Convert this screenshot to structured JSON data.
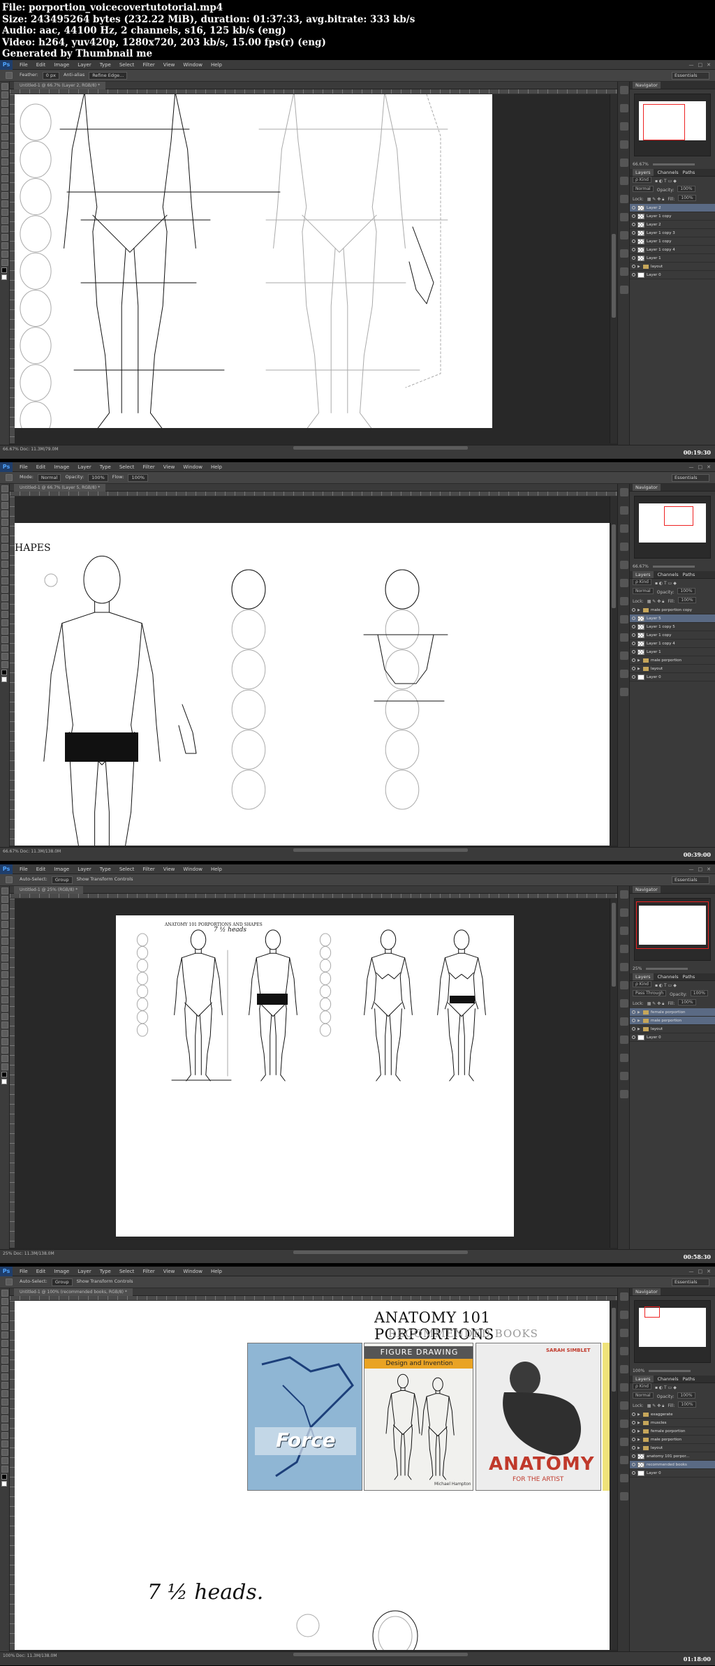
{
  "file_info": {
    "file": "File: porportion_voicecovertutotorial.mp4",
    "size": "Size: 243495264 bytes (232.22 MiB), duration: 01:37:33, avg.bitrate: 333 kb/s",
    "audio": "Audio: aac, 44100 Hz, 2 channels, s16, 125 kb/s (eng)",
    "video": "Video: h264, yuv420p, 1280x720, 203 kb/s, 15.00 fps(r) (eng)",
    "generated": "Generated by Thumbnail me"
  },
  "app": {
    "logo": "Ps",
    "menus": [
      "File",
      "Edit",
      "Image",
      "Layer",
      "Type",
      "Select",
      "Filter",
      "View",
      "Window",
      "Help"
    ],
    "workspace": "Essentials",
    "navigator_tab": "Navigator",
    "layers_tabs": [
      "Layers",
      "Channels",
      "Paths"
    ]
  },
  "frames": [
    {
      "timestamp": "00:19:30",
      "doc_tab": "Untitled-1 @ 66.7% (Layer 2, RGB/8) *",
      "zoom": "66.67%",
      "status": "66.67%     Doc: 11.3M/79.0M",
      "options": [
        "Feather:",
        "0 px",
        "Anti-alias",
        "Refine Edge..."
      ],
      "blend_mode": "Normal",
      "opacity": "100%",
      "fill": "100%",
      "layers": [
        {
          "name": "Layer 2",
          "type": "layer",
          "selected": true
        },
        {
          "name": "Layer 1 copy",
          "type": "layer",
          "selected": false
        },
        {
          "name": "Layer 2",
          "type": "layer",
          "selected": false
        },
        {
          "name": "Layer 1 copy 3",
          "type": "layer",
          "selected": false
        },
        {
          "name": "Layer 1 copy",
          "type": "layer",
          "selected": false
        },
        {
          "name": "Layer 1 copy 4",
          "type": "layer",
          "selected": false
        },
        {
          "name": "Layer 1",
          "type": "layer",
          "selected": false
        },
        {
          "name": "layout",
          "type": "folder",
          "selected": false
        },
        {
          "name": "Layer 0",
          "type": "background",
          "selected": false
        }
      ]
    },
    {
      "timestamp": "00:39:00",
      "doc_tab": "Untitled-1 @ 66.7% (Layer 5, RGB/8) *",
      "zoom": "66.67%",
      "status": "66.67%     Doc: 11.3M/138.0M",
      "options": [
        "Mode:",
        "Normal",
        "Opacity:",
        "100%",
        "Flow:",
        "100%"
      ],
      "page_heading": "HAPES",
      "blend_mode": "Normal",
      "opacity": "100%",
      "fill": "100%",
      "layers": [
        {
          "name": "male porportion copy",
          "type": "folder",
          "selected": false
        },
        {
          "name": "Layer 5",
          "type": "layer",
          "selected": true
        },
        {
          "name": "Layer 1 copy 5",
          "type": "layer",
          "selected": false
        },
        {
          "name": "Layer 1 copy",
          "type": "layer",
          "selected": false
        },
        {
          "name": "Layer 1 copy 4",
          "type": "layer",
          "selected": false
        },
        {
          "name": "Layer 1",
          "type": "layer",
          "selected": false
        },
        {
          "name": "male porportion",
          "type": "folder",
          "selected": false
        },
        {
          "name": "layout",
          "type": "folder",
          "selected": false
        },
        {
          "name": "Layer 0",
          "type": "background",
          "selected": false
        }
      ]
    },
    {
      "timestamp": "00:58:30",
      "doc_tab": "Untitled-1 @ 25% (RGB/8) *",
      "zoom": "25%",
      "status": "25%     Doc: 11.3M/138.0M",
      "options": [
        "Auto-Select:",
        "Group",
        "Show Transform Controls"
      ],
      "page_heading": "ANATOMY 101 PORPORTIONS AND SHAPES",
      "hw_note": "7 ½ heads",
      "blend_mode": "Pass Through",
      "opacity": "100%",
      "fill": "100%",
      "layers": [
        {
          "name": "female porportion",
          "type": "folder",
          "selected": true
        },
        {
          "name": "male porportion",
          "type": "folder",
          "selected": true
        },
        {
          "name": "layout",
          "type": "folder",
          "selected": false
        },
        {
          "name": "Layer 0",
          "type": "background",
          "selected": false
        }
      ]
    },
    {
      "timestamp": "01:18:00",
      "doc_tab": "Untitled-1 @ 100% (recommended books, RGB/8) *",
      "zoom": "100%",
      "status": "100%     Doc: 11.3M/138.0M",
      "options": [
        "Auto-Select:",
        "Group",
        "Show Transform Controls"
      ],
      "title": "ANATOMY 101 PORPORTIONS",
      "subtitle": "RECOMMENDED BOOKS",
      "hw_note": "7 ½ heads.",
      "blend_mode": "Normal",
      "opacity": "100%",
      "fill": "100%",
      "books": [
        {
          "title": "Force",
          "color": "#8fb6d4"
        },
        {
          "title": "FIGURE DRAWING",
          "subtitle": "Design and Invention",
          "author": "Michael Hampton",
          "color": "#f1f1ee"
        },
        {
          "title": "ANATOMY",
          "subtitle": "FOR THE ARTIST",
          "author": "SARAH SIMBLET",
          "color": "#ededed"
        }
      ],
      "layers": [
        {
          "name": "exaggerate",
          "type": "folder",
          "selected": false
        },
        {
          "name": "muscles",
          "type": "folder",
          "selected": false
        },
        {
          "name": "female porportion",
          "type": "folder",
          "selected": false
        },
        {
          "name": "male porportion",
          "type": "folder",
          "selected": false
        },
        {
          "name": "layout",
          "type": "folder",
          "selected": false
        },
        {
          "name": "anatomy 101 porpor...",
          "type": "layer",
          "selected": false
        },
        {
          "name": "recommended books",
          "type": "layer",
          "selected": true
        },
        {
          "name": "Layer 0",
          "type": "background",
          "selected": false
        }
      ]
    }
  ]
}
